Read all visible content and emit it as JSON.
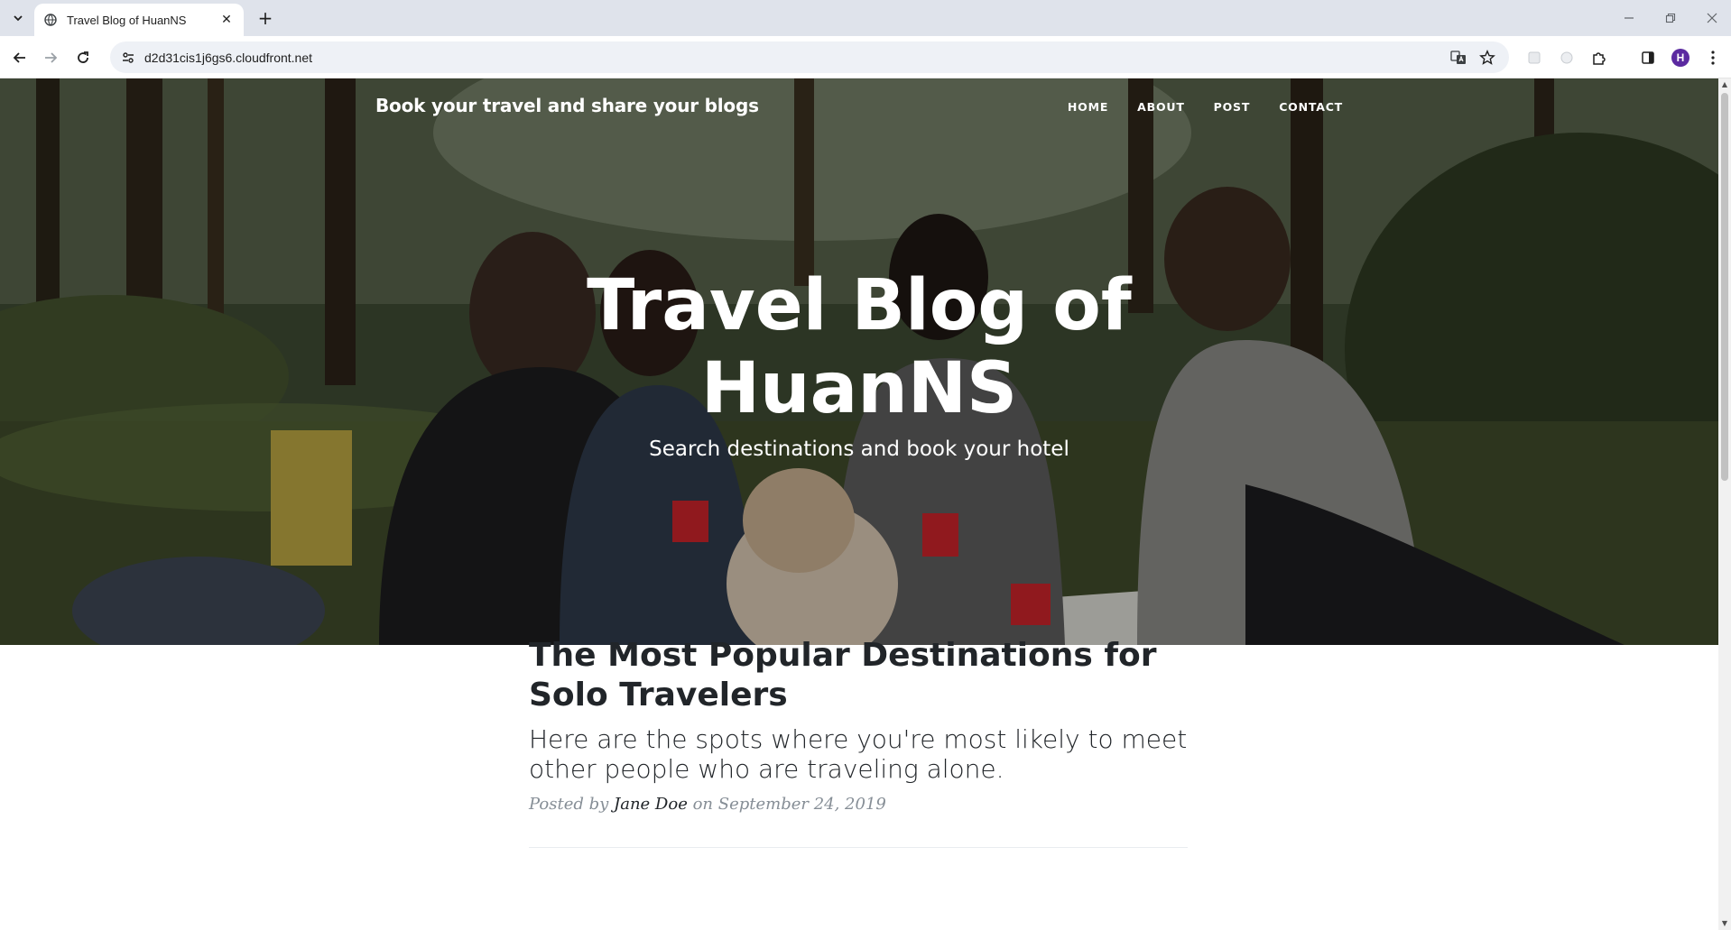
{
  "browser": {
    "tab_title": "Travel Blog of HuanNS",
    "tab_close": "✕",
    "new_tab": "+",
    "url": "d2d31cis1j6gs6.cloudfront.net",
    "profile_initial": "H",
    "window_controls": {
      "minimize": "—",
      "restore": "❐",
      "close": "✕"
    }
  },
  "site": {
    "brand": "Book your travel and share your blogs",
    "nav": [
      "HOME",
      "ABOUT",
      "POST",
      "CONTACT"
    ]
  },
  "hero": {
    "title_line1": "Travel Blog of",
    "title_line2": "HuanNS",
    "subtitle": "Search destinations and book your hotel"
  },
  "post": {
    "title": "The Most Popular Destinations for Solo Travelers",
    "subtitle": "Here are the spots where you're most likely to meet other people who are traveling alone.",
    "meta_prefix": "Posted by",
    "author": "Jane Doe",
    "meta_on": "on September 24, 2019"
  },
  "colors": {
    "accent_profile": "#5b2aa0",
    "text_dark": "#212529",
    "text_muted": "#868e96"
  },
  "icons": [
    "tab-list-icon",
    "globe-icon",
    "close-icon",
    "plus-icon",
    "back-icon",
    "forward-icon",
    "reload-icon",
    "site-info-icon",
    "translate-icon",
    "star-icon",
    "extension-icon",
    "sidepanel-icon",
    "menu-icon"
  ]
}
